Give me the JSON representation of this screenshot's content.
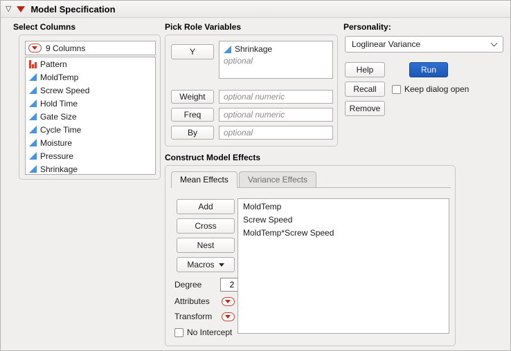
{
  "window": {
    "title": "Model Specification"
  },
  "icons": {
    "disclosure_open": "▽"
  },
  "colors": {
    "run_button": "#1c57b6",
    "continuous_icon": "#4a94dd",
    "red_triangle": "#c0271a",
    "pattern_bars": "#cf4437"
  },
  "select_columns": {
    "header": "Select Columns",
    "count_label": "9 Columns",
    "columns": [
      {
        "name": "Pattern",
        "icon": "bar-chart"
      },
      {
        "name": "MoldTemp",
        "icon": "continuous"
      },
      {
        "name": "Screw Speed",
        "icon": "continuous"
      },
      {
        "name": "Hold Time",
        "icon": "continuous"
      },
      {
        "name": "Gate Size",
        "icon": "continuous"
      },
      {
        "name": "Cycle Time",
        "icon": "continuous"
      },
      {
        "name": "Moisture",
        "icon": "continuous"
      },
      {
        "name": "Pressure",
        "icon": "continuous"
      },
      {
        "name": "Shrinkage",
        "icon": "continuous"
      }
    ]
  },
  "pick_roles": {
    "header": "Pick Role Variables",
    "y_button": "Y",
    "y_value": "Shrinkage",
    "y_placeholder": "optional",
    "weight_button": "Weight",
    "weight_placeholder": "optional numeric",
    "freq_button": "Freq",
    "freq_placeholder": "optional numeric",
    "by_button": "By",
    "by_placeholder": "optional"
  },
  "personality": {
    "label": "Personality:",
    "selected": "Loglinear Variance",
    "help_button": "Help",
    "run_button": "Run",
    "recall_button": "Recall",
    "keep_dialog_open_label": "Keep dialog open",
    "remove_button": "Remove"
  },
  "construct": {
    "header": "Construct Model Effects",
    "tabs": [
      {
        "label": "Mean Effects"
      },
      {
        "label": "Variance Effects"
      }
    ],
    "add_button": "Add",
    "cross_button": "Cross",
    "nest_button": "Nest",
    "macros_button": "Macros",
    "degree_label": "Degree",
    "degree_value": "2",
    "attributes_label": "Attributes",
    "transform_label": "Transform",
    "no_intercept_label": "No Intercept",
    "effects": [
      "MoldTemp",
      "Screw Speed",
      "MoldTemp*Screw Speed"
    ]
  }
}
